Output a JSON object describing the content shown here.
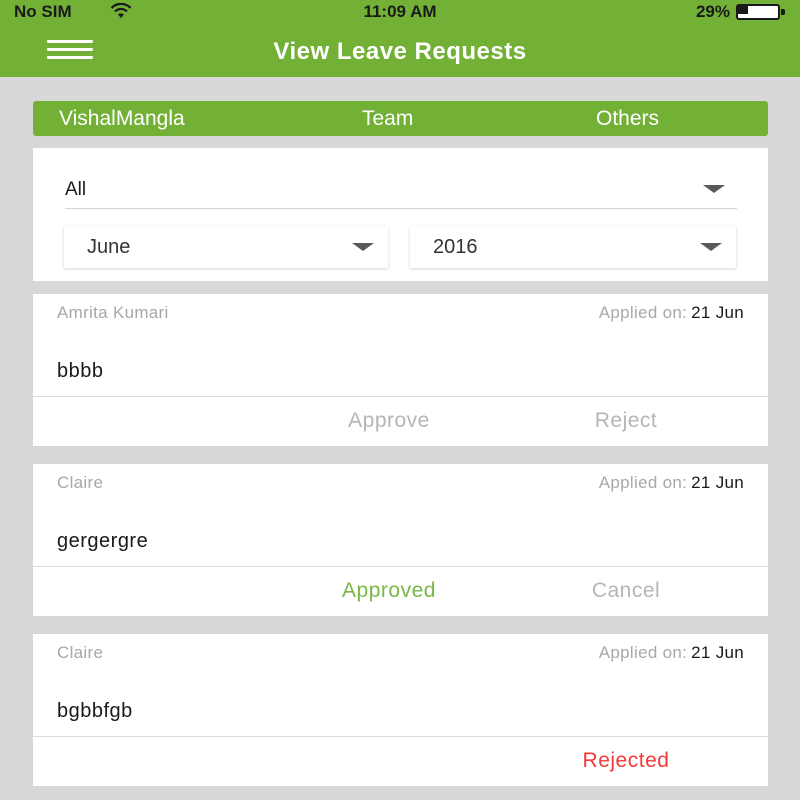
{
  "status_bar": {
    "carrier": "No SIM",
    "time": "11:09 AM",
    "battery": "29%",
    "battery_level": 0.29
  },
  "header": {
    "title": "View Leave Requests",
    "menu_icon": "hamburger-menu-icon",
    "background_color": "#72b136"
  },
  "tabs": [
    {
      "label": "VishalMangla"
    },
    {
      "label": "Team"
    },
    {
      "label": "Others"
    }
  ],
  "filters": {
    "type": "All",
    "month": "June",
    "year": "2016"
  },
  "requests": [
    {
      "name": "Amrita Kumari",
      "applied_label": "Applied on:",
      "applied_date": "21 Jun",
      "reason": "bbbb",
      "approve_label": "Approve",
      "reject_label": "Reject"
    },
    {
      "name": "Claire",
      "applied_label": "Applied on:",
      "applied_date": "21 Jun",
      "reason": "gergergre",
      "status": "Approved",
      "cancel_label": "Cancel"
    },
    {
      "name": "Claire",
      "applied_label": "Applied on:",
      "applied_date": "21 Jun",
      "reason": "bgbbfgb",
      "status": "Rejected"
    }
  ],
  "colors": {
    "approved": "#78b844",
    "rejected": "#f03a3a"
  }
}
